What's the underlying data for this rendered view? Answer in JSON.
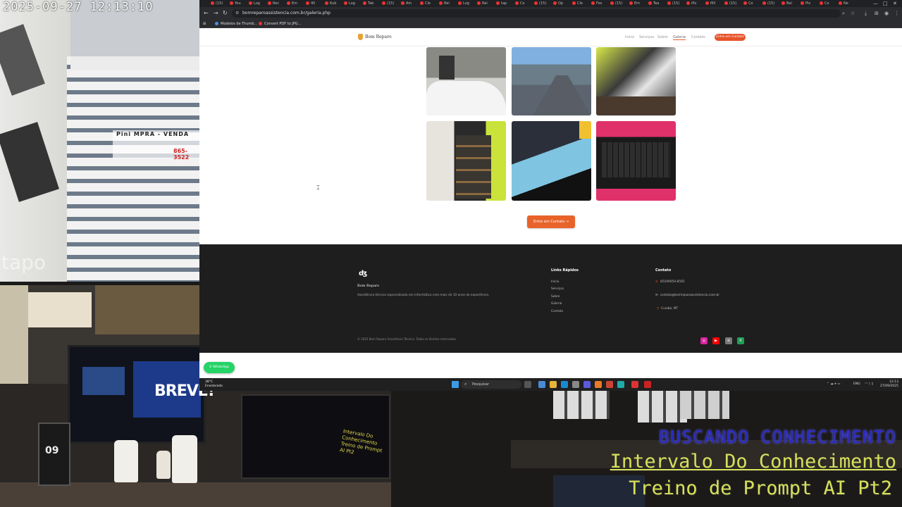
{
  "camera": {
    "timestamp": "2025-09-27  12:13:10",
    "logo": "tapo",
    "sign_text": "Pini   MPRA - VENDA",
    "sign_phone": "865-3522"
  },
  "webcam": {
    "monitor_text": "BREVE!",
    "calendar_day": "09",
    "monitor2_text": "Intervalo Do Conhecimento Treino de Prompt AI Pt2"
  },
  "overlay": {
    "line1": "BUSCANDO CONHECIMENTO",
    "line2": "Intervalo Do Conhecimento",
    "line3": "Treino de Prompt AI Pt2"
  },
  "browser": {
    "url": "bomreparoassistencia.com.br/galeria.php",
    "bookmarks": [
      {
        "label": "Modelos de Thumb...",
        "color": "#4a90e2"
      },
      {
        "label": "Convert PDF to JPG...",
        "color": "#e33"
      }
    ],
    "tabs": [
      "(15)",
      "You",
      "Log",
      "Rec",
      "Em",
      "40",
      "Kub",
      "Log",
      "Tab",
      "(15)",
      "Am",
      "Cle",
      "Rei",
      "Log",
      "Rei",
      "tap",
      "Co",
      "(15)",
      "Op",
      "Cle",
      "Fes",
      "(15)",
      "Em",
      "Tea",
      "(15)",
      "iPo",
      "Mil",
      "(15)",
      "Co",
      "(15)",
      "Bal",
      "Pix",
      "Co",
      "Ne"
    ]
  },
  "site": {
    "brand": "Bom Reparo",
    "nav": [
      {
        "label": "Início",
        "active": false
      },
      {
        "label": "Serviços",
        "active": false
      },
      {
        "label": "Sobre",
        "active": false
      },
      {
        "label": "Galeria",
        "active": true
      },
      {
        "label": "Contato",
        "active": false
      }
    ],
    "nav_cta": "Entre em Contato",
    "gallery_cta": "Entre em Contato →"
  },
  "footer": {
    "logo_glyph": "ʤ",
    "brand": "Bom Reparo",
    "description": "Assistência técnica especializada em informática com mais de 10 anos de experiência.",
    "quick_links_title": "Links Rápidos",
    "quick_links": [
      "Início",
      "Serviços",
      "Sobre",
      "Galeria",
      "Contato"
    ],
    "contact_title": "Contato",
    "phone": "(65)99950-8565",
    "email": "contato@bomreparoassistencia.com.br",
    "location": "Cuiabá, MT",
    "copyright": "© 2025 Bom Reparo Assistência Técnica. Todos os direitos reservados.",
    "social": [
      {
        "name": "instagram-icon",
        "color": "#d6249f"
      },
      {
        "name": "youtube-icon",
        "color": "#ff0000"
      },
      {
        "name": "notepad-icon",
        "color": "#7a7a7a"
      },
      {
        "name": "excel-icon",
        "color": "#1f9d55"
      }
    ]
  },
  "whatsapp_label": "WhatsApp",
  "taskbar": {
    "weather_temp": "38°C",
    "weather_desc": "Ensolarado",
    "search_placeholder": "Pesquisar",
    "lang": "ENG",
    "time": "12:13",
    "date": "27/09/2025"
  },
  "colors": {
    "accent": "#e8532a",
    "footer_bg": "#1e1e1e",
    "whatsapp": "#25d366"
  }
}
